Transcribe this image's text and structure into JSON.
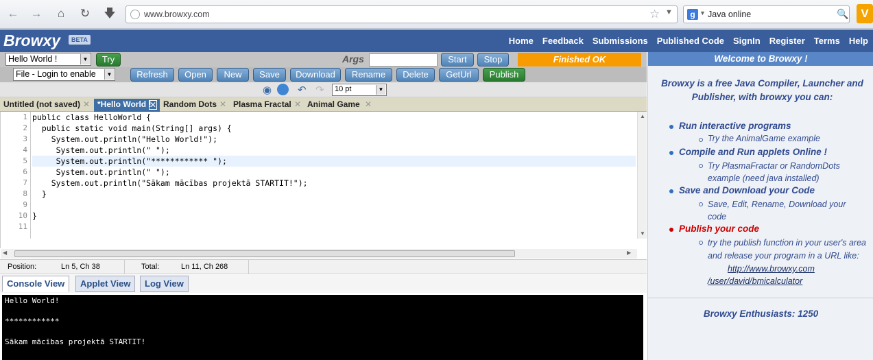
{
  "browser": {
    "url": "www.browxy.com",
    "search_text": "Java online",
    "search_engine": "g"
  },
  "site": {
    "logo": "Browxy",
    "badge": "BETA",
    "menu": [
      "Home",
      "Feedback",
      "Submissions",
      "Published Code",
      "SignIn",
      "Register",
      "Terms",
      "Help"
    ]
  },
  "ide": {
    "program_select": "Hello World !",
    "try_label": "Try",
    "args_label": "Args",
    "args_value": "",
    "start_label": "Start",
    "stop_label": "Stop",
    "status": "Finished OK",
    "file_select": "File - Login to enable",
    "buttons": [
      "Refresh",
      "Open",
      "New",
      "Save",
      "Download",
      "Rename",
      "Delete",
      "GetUrl"
    ],
    "publish_label": "Publish",
    "font_size": "10 pt",
    "tabs": [
      "Untitled (not saved)",
      "*Hello World !",
      "Random Dots",
      "Plasma Fractal",
      "Animal Game"
    ],
    "active_tab": 1,
    "code_lines": [
      "public class HelloWorld {",
      "  public static void main(String[] args) {",
      "    System.out.println(\"Hello World!\");",
      "     System.out.println(\" \");",
      "     System.out.println(\"************ \");",
      "     System.out.println(\" \");",
      "    System.out.println(\"Sākam mācības projektā STARTIT!\");",
      "  }",
      "",
      "}",
      ""
    ],
    "highlight_line": 5,
    "status_bar": {
      "position_label": "Position:",
      "position_value": "Ln 5, Ch 38",
      "total_label": "Total:",
      "total_value": "Ln 11, Ch 268"
    },
    "view_tabs": [
      "Console View",
      "Applet View",
      "Log View"
    ],
    "console_lines": [
      "Hello World!",
      "",
      "************",
      "",
      "Sākam mācības projektā STARTIT!"
    ]
  },
  "sidebar": {
    "welcome": "Welcome to Browxy !",
    "intro": "Browxy is a free Java Compiler, Launcher and Publisher, with browxy you can:",
    "items": [
      {
        "title": "Run interactive programs",
        "sub": "Try the AnimalGame example"
      },
      {
        "title": "Compile and Run applets Online !",
        "sub": "Try PlasmaFractar or RandomDots example (need java installed)"
      },
      {
        "title": "Save and Download your Code",
        "sub": "Save, Edit, Rename, Download your code"
      },
      {
        "title": "Publish your code",
        "sub": "try the publish function in your user's area and release your program in a URL like:",
        "link": "http://www.browxy.com /user/david/bmicalculator"
      }
    ],
    "enthusiasts": "Browxy Enthusiasts: 1250"
  },
  "colors": {
    "header": "#3a5d9c",
    "status_orange": "#f79b00",
    "publish_red": "#cc0000",
    "sidebar_text": "#2f4a8f"
  }
}
